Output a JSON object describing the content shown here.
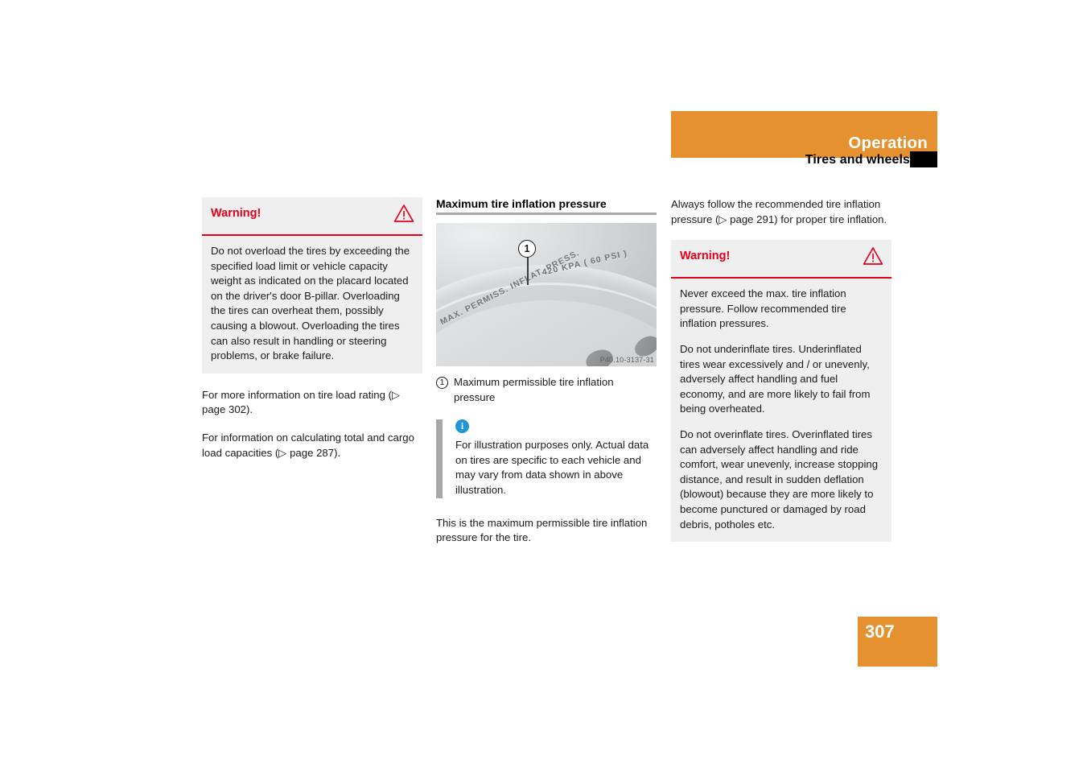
{
  "header": {
    "section": "Operation",
    "subsection": "Tires and wheels"
  },
  "page_number": "307",
  "left_column": {
    "warning": {
      "title": "Warning!",
      "paragraphs": [
        "Do not overload the tires by exceeding the specified load limit or vehicle capacity weight as indicated on the placard located on the driver's door B-pillar. Overloading the tires can overheat them, possibly causing a blowout. Overloading the tires can also result in handling or steering problems, or brake failure."
      ]
    },
    "paragraphs": [
      "For more information on tire load rating (▷ page 302).",
      "For information on calculating total and cargo load capacities (▷ page 287)."
    ]
  },
  "middle_column": {
    "heading": "Maximum tire inflation pressure",
    "figure": {
      "callout_number": "1",
      "tire_marking_line1": "MAX. PERMISS. INFLAT. PRESS.",
      "tire_marking_line2": "420 KPA  ( 60 PSI )",
      "code": "P40.10-3137-31"
    },
    "caption": {
      "number": "1",
      "text": "Maximum permissible tire inflation pressure"
    },
    "info_box": {
      "text": "For illustration purposes only. Actual data on tires are specific to each vehicle and may vary from data shown in above illustration."
    },
    "paragraphs": [
      "This is the maximum permissible tire inflation pressure for the tire."
    ]
  },
  "right_column": {
    "paragraphs": [
      "Always follow the recommended tire inflation pressure (▷ page 291) for proper tire inflation."
    ],
    "warning": {
      "title": "Warning!",
      "paragraphs": [
        "Never exceed the max. tire inflation pressure. Follow recommended tire inflation pressures.",
        "Do not underinflate tires. Underinflated tires wear excessively and / or unevenly, adversely affect handling and fuel economy, and are more likely to fail from being overheated.",
        "Do not overinflate tires. Overinflated tires can adversely affect handling and ride comfort, wear unevenly, increase stopping distance, and result in sudden deflation (blowout) because they are more likely to become punctured or damaged by road debris, potholes etc."
      ]
    }
  },
  "colors": {
    "accent_orange": "#e5912f",
    "warning_red": "#e4001b",
    "info_blue": "#2196d6",
    "box_gray": "#efefef",
    "rule_gray": "#a8a8a8"
  }
}
